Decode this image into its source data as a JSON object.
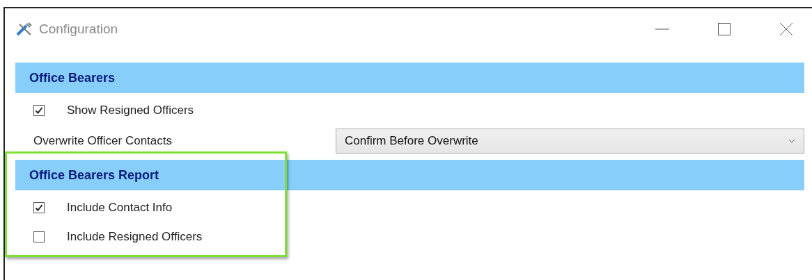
{
  "window": {
    "title": "Configuration"
  },
  "sections": [
    {
      "title": "Office Bearers",
      "highlighted": false,
      "items": [
        {
          "kind": "checkbox",
          "label": "Show Resigned Officers",
          "checked": true
        },
        {
          "kind": "dropdown",
          "label": "Overwrite Officer Contacts",
          "value": "Confirm Before Overwrite"
        }
      ]
    },
    {
      "title": "Office Bearers Report",
      "highlighted": true,
      "items": [
        {
          "kind": "checkbox",
          "label": "Include Contact Info",
          "checked": true
        },
        {
          "kind": "checkbox",
          "label": "Include Resigned Officers",
          "checked": false
        }
      ]
    }
  ]
}
